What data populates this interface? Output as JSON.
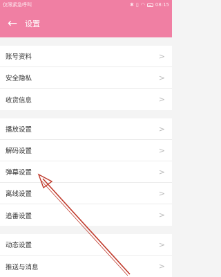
{
  "status_bar": {
    "left_text": "仅限紧急呼叫",
    "right_icons": [
      "star-icon",
      "signal-icon",
      "wifi-icon",
      "battery-icon"
    ],
    "time": "08:15"
  },
  "header": {
    "back_icon": "arrow-left-icon",
    "title": "设置",
    "color": "#f07fa3"
  },
  "groups": [
    {
      "items": [
        {
          "label": "账号资料"
        },
        {
          "label": "安全隐私"
        },
        {
          "label": "收货信息"
        }
      ]
    },
    {
      "items": [
        {
          "label": "播放设置"
        },
        {
          "label": "解码设置"
        },
        {
          "label": "弹幕设置"
        },
        {
          "label": "离线设置"
        },
        {
          "label": "追番设置"
        }
      ]
    },
    {
      "items": [
        {
          "label": "动态设置"
        },
        {
          "label": "推送与消息"
        }
      ]
    }
  ],
  "annotation": {
    "type": "red-arrow",
    "target": "弹幕设置",
    "color": "#c0392b"
  }
}
